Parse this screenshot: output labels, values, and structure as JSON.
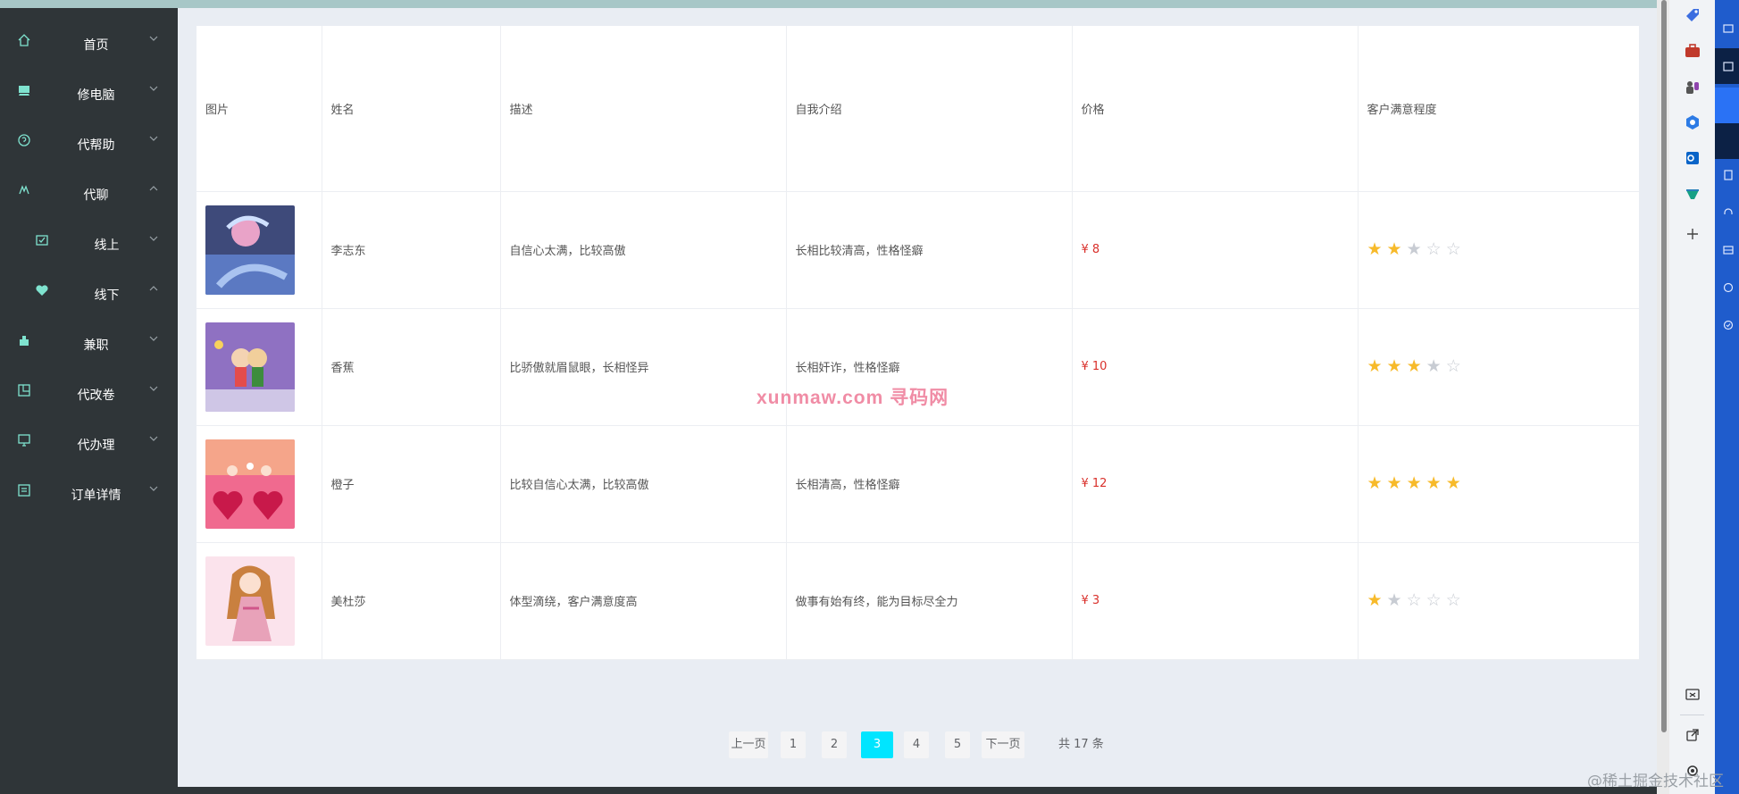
{
  "sidebar": {
    "items": [
      {
        "label": "首页",
        "icon": "home-icon",
        "expanded": false
      },
      {
        "label": "修电脑",
        "icon": "computer-repair-icon",
        "expanded": false
      },
      {
        "label": "代帮助",
        "icon": "help-icon",
        "expanded": false
      },
      {
        "label": "代聊",
        "icon": "chat-icon",
        "expanded": true
      },
      {
        "label": "线上",
        "icon": "checkbox-icon",
        "expanded": false,
        "sub": true
      },
      {
        "label": "线下",
        "icon": "heart-icon",
        "expanded": true,
        "sub": true
      },
      {
        "label": "兼职",
        "icon": "parttime-icon",
        "expanded": false
      },
      {
        "label": "代改卷",
        "icon": "exam-icon",
        "expanded": false
      },
      {
        "label": "代办理",
        "icon": "monitor-icon",
        "expanded": false
      },
      {
        "label": "订单详情",
        "icon": "order-icon",
        "expanded": false
      }
    ]
  },
  "table": {
    "headers": [
      "图片",
      "姓名",
      "描述",
      "自我介绍",
      "价格",
      "客户满意程度"
    ],
    "rows": [
      {
        "name": "李志东",
        "desc": "自信心太满，比较高傲",
        "intro": "长相比较清高，性格怪癖",
        "price": "¥ 8",
        "rating": 2,
        "thumb": "avatar-anime-blue"
      },
      {
        "name": "香蕉",
        "desc": "比骄傲就眉鼠眼，长相怪异",
        "intro": "长相奸诈，性格怪癖",
        "price": "¥ 10",
        "rating": 3,
        "thumb": "avatar-couple"
      },
      {
        "name": "橙子",
        "desc": "比较自信心太满，比较高傲",
        "intro": "长相清高，性格怪癖",
        "price": "¥ 12",
        "rating": 5,
        "thumb": "avatar-hearts"
      },
      {
        "name": "美杜莎",
        "desc": "体型滴绕，客户满意度高",
        "intro": "做事有始有终，能为目标尽全力",
        "price": "¥ 3",
        "rating": 1,
        "thumb": "avatar-girl-pink"
      }
    ]
  },
  "pagination": {
    "prev": "上一页",
    "pages": [
      "1",
      "2",
      "3",
      "4",
      "5"
    ],
    "current": "3",
    "next": "下一页",
    "total": "共 17 条"
  },
  "watermark": "xunmaw.com 寻码网",
  "credit": "@稀土掘金技术社区",
  "colors": {
    "sidebar_bg": "#2f3538",
    "accent": "#00e5ff",
    "price": "#d9302b",
    "star": "#f7ba2a",
    "edge_blue": "#1f5ccc"
  }
}
